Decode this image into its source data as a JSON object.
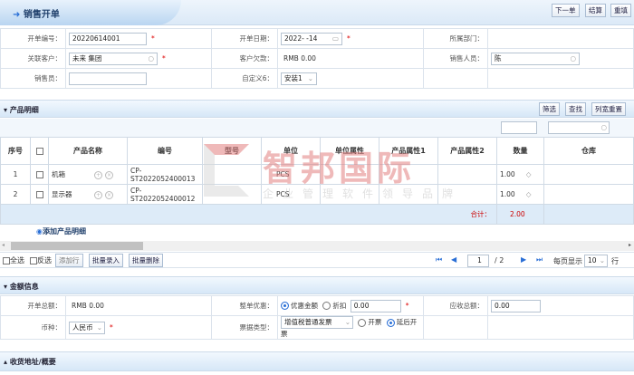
{
  "header": {
    "title": "销售开单",
    "buttons": [
      "下一单",
      "结算",
      "重填"
    ]
  },
  "form": {
    "order_no_label": "开单编号：",
    "order_no": "20220614001",
    "date_label": "开单日期：",
    "date": "2022-   -14",
    "dept_label": "所属部门：",
    "customer_label": "关联客户：",
    "customer": "未来      集团",
    "debt_label": "客户欠款：",
    "debt": "RMB 0.00",
    "salesman_label": "销售人员：",
    "salesman": "陈",
    "seller_label": "销售员：",
    "seller": "",
    "custom6_label": "自定义6：",
    "custom6": "安装1"
  },
  "products": {
    "section_title": "产品明细",
    "buttons": [
      "筛选",
      "查找",
      "列宽重置"
    ],
    "columns": [
      "序号",
      "",
      "产品名称",
      "编号",
      "型号",
      "单位",
      "单位属性",
      "产品属性1",
      "产品属性2",
      "数量",
      "仓库"
    ],
    "rows": [
      {
        "no": "1",
        "name": "机箱",
        "code": "CP-ST2022052400013",
        "model": "",
        "unit": "PCS",
        "qty": "1.00"
      },
      {
        "no": "2",
        "name": "显示器",
        "code": "CP-ST2022052400012",
        "model": "",
        "unit": "PCS",
        "qty": "1.00"
      }
    ],
    "total_label": "合计：",
    "total": "2.00",
    "add_link": "添加产品明细",
    "select_all": "全选",
    "invert": "反选",
    "toolbar": [
      "添加行",
      "批量录入",
      "批量删除"
    ],
    "page": "1",
    "pages": "/ 2",
    "per_page_label": "每页显示",
    "per_page": "10",
    "per_page_suffix": "行"
  },
  "watermark": {
    "brand": "智邦国际",
    "slogan": "企业管理软件领导品牌"
  },
  "amount": {
    "section_title": "金额信息",
    "total_label": "开单总额：",
    "total": "RMB 0.00",
    "discount_label": "整单优惠：",
    "opt_amount": "优惠金额",
    "opt_rate": "折扣",
    "discount": "0.00",
    "receivable_label": "应收总额：",
    "receivable": "0.00",
    "currency_label": "币种：",
    "currency": "人民币",
    "invoice_label": "票据类型：",
    "invoice": "增值税普通发票",
    "opt_invoice": "开票",
    "opt_later": "延后开票"
  },
  "shipping": {
    "section_title": "收货地址/概要"
  }
}
